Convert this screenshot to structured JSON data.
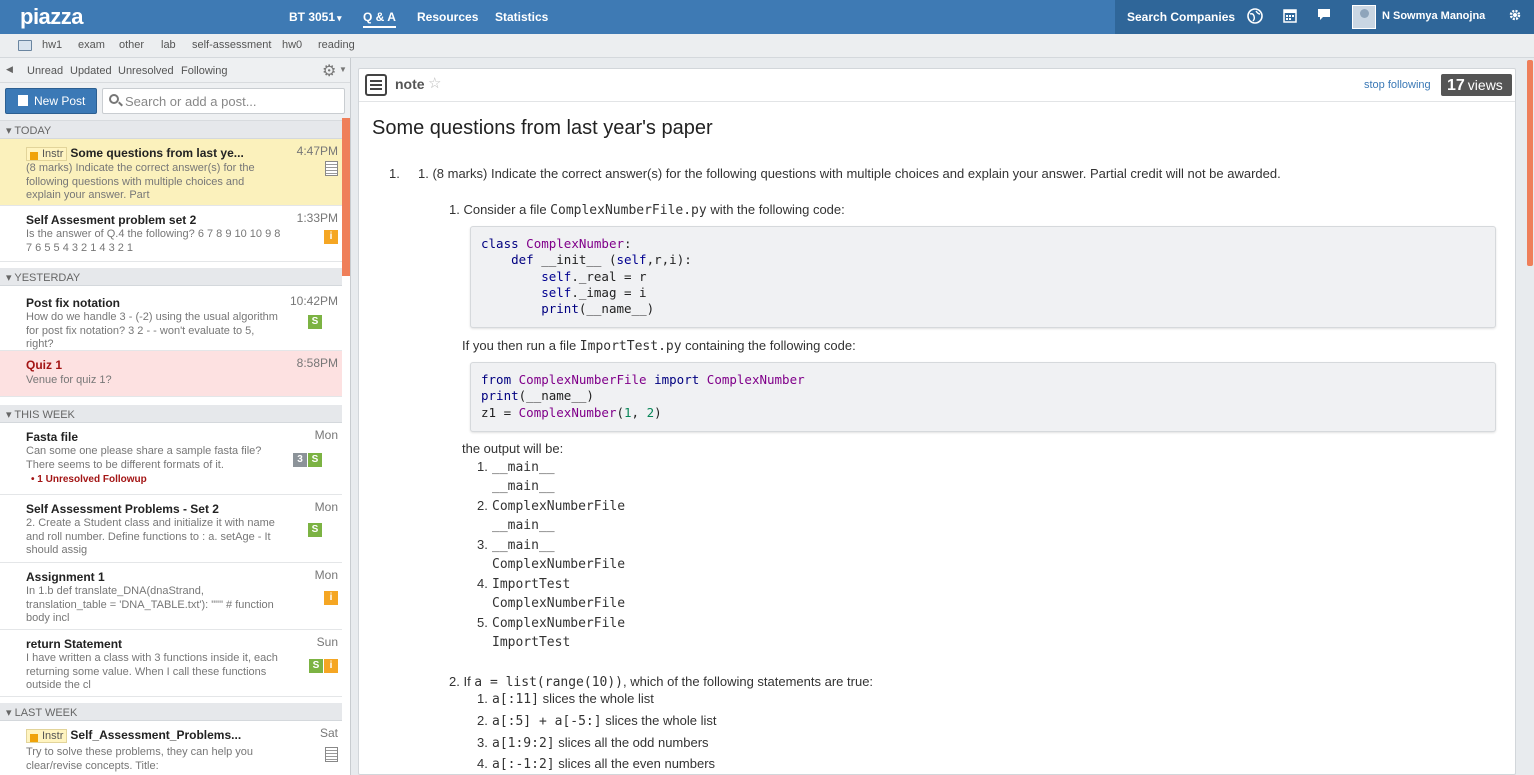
{
  "topbar": {
    "logo": "piazza",
    "course": "BT 3051",
    "course_caret": "▾",
    "nav_qa": "Q & A",
    "nav_resources": "Resources",
    "nav_statistics": "Statistics",
    "search_companies": "Search Companies",
    "user_name": "N Sowmya Manojna",
    "accent_color": "#3e7ab4"
  },
  "folders": [
    "hw1",
    "exam",
    "other",
    "lab",
    "self-assessment",
    "hw0",
    "reading"
  ],
  "filters": [
    "Unread",
    "Updated",
    "Unresolved",
    "Following"
  ],
  "actions": {
    "new_post": "New Post",
    "search_placeholder": "Search or add a post..."
  },
  "groups": {
    "today": "▾ TODAY",
    "yesterday": "▾ YESTERDAY",
    "this_week": "▾ THIS WEEK",
    "last_week": "▾ LAST WEEK"
  },
  "posts": [
    {
      "instr": "Instr",
      "title": "Some questions from last ye...",
      "time": "4:47PM",
      "snippet": "(8 marks) Indicate the correct answer(s) for the following questions with multiple choices and explain your answer. Part"
    },
    {
      "title": "Self Assesment problem set 2",
      "time": "1:33PM",
      "snippet": "Is the answer of Q.4 the following? 6 7 8 9 10 10 9 8 7 6 5 5 4 3 2 1 4 3 2 1",
      "badge1": "i"
    },
    {
      "title": "Post fix notation",
      "time": "10:42PM",
      "snippet": "How do we handle 3 - (-2) using the usual algorithm for post fix notation? 3 2 - - won't evaluate to 5, right?",
      "badge1": "S"
    },
    {
      "title": "Quiz 1",
      "time": "8:58PM",
      "snippet": "Venue for quiz 1?"
    },
    {
      "title": "Fasta file",
      "time": "Mon",
      "snippet": "Can some one please share a sample fasta file? There seems to be different formats of it.",
      "badge_num": "3",
      "badge1": "S",
      "followup": "• 1 Unresolved Followup"
    },
    {
      "title": "Self Assessment Problems - Set 2",
      "time": "Mon",
      "snippet": "2. Create a Student class and initialize it with name and roll number. Define functions to : a. setAge - It should assig",
      "badge1": "S"
    },
    {
      "title": "Assignment 1",
      "time": "Mon",
      "snippet": "In 1.b def translate_DNA(dnaStrand, translation_table = 'DNA_TABLE.txt'): \"\"\" # function body incl",
      "badge1": "i"
    },
    {
      "title": "return Statement",
      "time": "Sun",
      "snippet": "I have written a class with 3 functions inside it, each returning some value. When I call these functions outside the cl",
      "badge1": "S",
      "badge2": "i"
    },
    {
      "instr": "Instr",
      "title": "Self_Assessment_Problems...",
      "time": "Sat",
      "snippet": "Try to solve these problems, they can help you clear/revise concepts. Title:"
    }
  ],
  "note": {
    "type": "note",
    "star": "☆",
    "stop_following": "stop following",
    "views_count": "17",
    "views_label": "views",
    "title": "Some questions from last year's paper",
    "q1_num": "1.",
    "q1_text": "1. (8 marks) Indicate the correct answer(s) for the following questions with multiple choices and explain your answer. Partial credit will not be awarded.",
    "sub1_pre": "1. Consider a file ",
    "sub1_file": "ComplexNumberFile.py",
    "sub1_post": " with the following code:",
    "code1": [
      "class ComplexNumber:",
      "    def __init__ (self,r,i):",
      "        self._real = r",
      "        self._imag = i",
      "        print(__name__)"
    ],
    "run_pre": "If you then run a file ",
    "run_file": "ImportTest.py",
    "run_post": " containing the following code:",
    "code2": [
      "from ComplexNumberFile import ComplexNumber",
      "print(__name__)",
      "z1 = ComplexNumber(1, 2)"
    ],
    "output_label": "the output will be:",
    "options1": [
      {
        "n": "1.",
        "l1": "__main__",
        "l2": "__main__"
      },
      {
        "n": "2.",
        "l1": "ComplexNumberFile",
        "l2": "__main__"
      },
      {
        "n": "3.",
        "l1": "__main__",
        "l2": "ComplexNumberFile"
      },
      {
        "n": "4.",
        "l1": "ImportTest",
        "l2": "ComplexNumberFile"
      },
      {
        "n": "5.",
        "l1": "ComplexNumberFile",
        "l2": "ImportTest"
      }
    ],
    "sub2_pre": "2. If ",
    "sub2_code": "a = list(range(10))",
    "sub2_post": ", which of the following statements are true:",
    "options2": [
      {
        "n": "1.",
        "code": "a[:11]",
        "text": " slices the whole list"
      },
      {
        "n": "2.",
        "code": "a[:5] + a[-5:]",
        "text": " slices the whole list"
      },
      {
        "n": "3.",
        "code": "a[1:9:2]",
        "text": " slices all the odd numbers"
      },
      {
        "n": "4.",
        "code": "a[:-1:2]",
        "text": " slices all the even numbers"
      }
    ]
  }
}
